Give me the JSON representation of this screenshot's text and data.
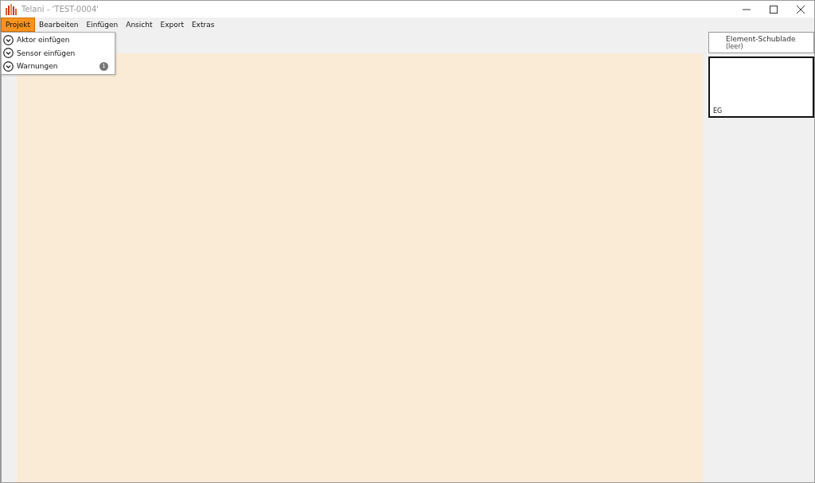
{
  "window": {
    "title": "Telani - 'TEST-0004'"
  },
  "menu": [
    {
      "label": "Projekt",
      "selected": true
    },
    {
      "label": "Bearbeiten",
      "selected": false
    },
    {
      "label": "Einfügen",
      "selected": false
    },
    {
      "label": "Ansicht",
      "selected": false
    },
    {
      "label": "Export",
      "selected": false
    },
    {
      "label": "Extras",
      "selected": false
    }
  ],
  "dropdown": [
    {
      "label": "Aktor einfügen"
    },
    {
      "label": "Sensor einfügen"
    },
    {
      "label": "Warnungen",
      "badge": "1"
    }
  ],
  "drawer": {
    "title": "Element-Schublade",
    "subtitle": "(leer)"
  },
  "floor_preview": {
    "label": "EG"
  }
}
